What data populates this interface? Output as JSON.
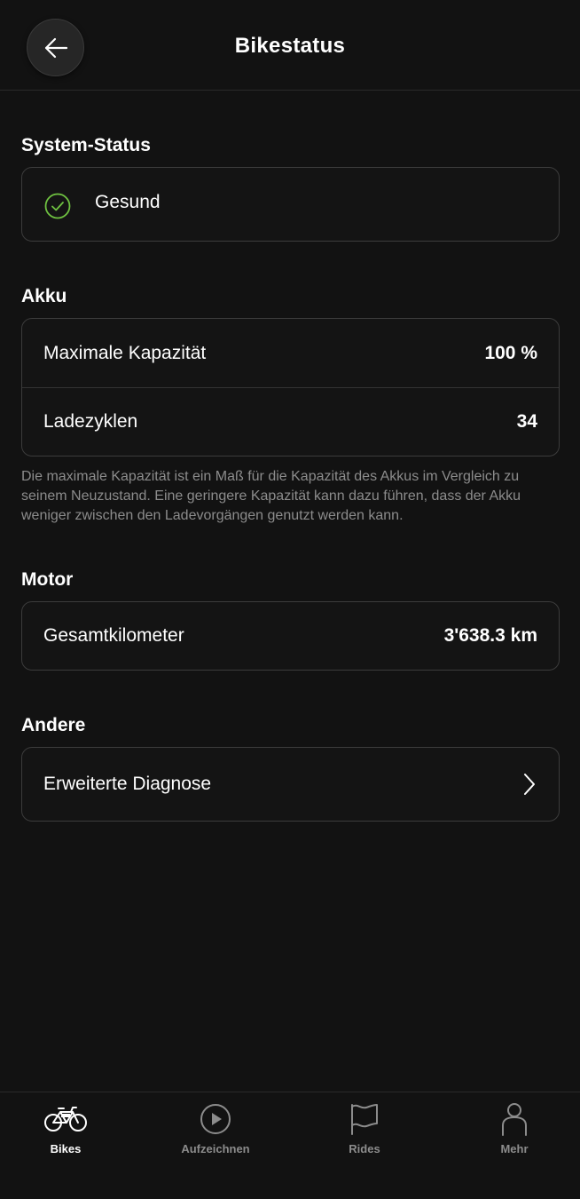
{
  "header": {
    "title": "Bikestatus"
  },
  "system_status": {
    "title": "System-Status",
    "status": "Gesund",
    "status_color": "#6fc241"
  },
  "akku": {
    "title": "Akku",
    "rows": [
      {
        "label": "Maximale Kapazität",
        "value": "100 %"
      },
      {
        "label": "Ladezyklen",
        "value": "34"
      }
    ],
    "note": "Die maximale Kapazität ist ein Maß für die Kapazität des Akkus im Vergleich zu seinem Neuzustand. Eine geringere Kapazität kann dazu führen, dass der Akku weniger zwischen den Ladevorgängen genutzt werden kann."
  },
  "motor": {
    "title": "Motor",
    "rows": [
      {
        "label": "Gesamtkilometer",
        "value": "3'638.3 km"
      }
    ]
  },
  "andere": {
    "title": "Andere",
    "rows": [
      {
        "label": "Erweiterte Diagnose",
        "icon": "chevron-right-icon"
      }
    ]
  },
  "nav": {
    "items": [
      {
        "label": "Bikes",
        "icon": "bike-icon",
        "active": true
      },
      {
        "label": "Aufzeichnen",
        "icon": "play-circle-icon",
        "active": false
      },
      {
        "label": "Rides",
        "icon": "flag-icon",
        "active": false
      },
      {
        "label": "Mehr",
        "icon": "person-icon",
        "active": false
      }
    ]
  }
}
